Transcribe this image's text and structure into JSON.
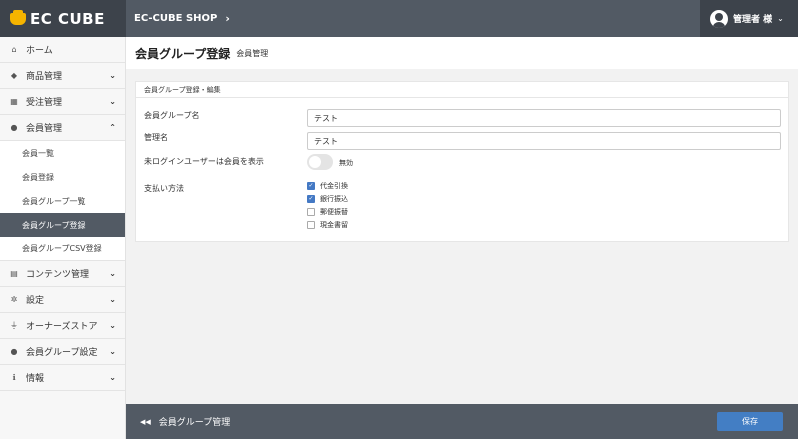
{
  "header": {
    "logo_text": "EC CUBE",
    "shop_name": "EC-CUBE SHOP",
    "shop_chevron": "›",
    "user_name": "管理者 様",
    "user_chevron": "⌄"
  },
  "sidebar": {
    "items": [
      {
        "label": "ホーム",
        "icon": "home-icon",
        "glyph": "⌂"
      },
      {
        "label": "商品管理",
        "icon": "cube-icon",
        "glyph": "◆",
        "arrow": "⌄"
      },
      {
        "label": "受注管理",
        "icon": "cart-icon",
        "glyph": "▦",
        "arrow": "⌄"
      },
      {
        "label": "会員管理",
        "icon": "users-icon",
        "glyph": "●",
        "arrow": "⌃"
      },
      {
        "label": "コンテンツ管理",
        "icon": "file-icon",
        "glyph": "▤",
        "arrow": "⌄"
      },
      {
        "label": "設定",
        "icon": "gear-icon",
        "glyph": "✲",
        "arrow": "⌄"
      },
      {
        "label": "オーナーズストア",
        "icon": "plug-icon",
        "glyph": "⏚",
        "arrow": "⌄"
      },
      {
        "label": "会員グループ設定",
        "icon": "users-icon",
        "glyph": "●",
        "arrow": "⌄"
      },
      {
        "label": "情報",
        "icon": "info-icon",
        "glyph": "ℹ",
        "arrow": "⌄"
      }
    ],
    "sub_items": [
      {
        "label": "会員一覧"
      },
      {
        "label": "会員登録"
      },
      {
        "label": "会員グループ一覧"
      },
      {
        "label": "会員グループ登録"
      },
      {
        "label": "会員グループCSV登録"
      }
    ]
  },
  "page": {
    "title": "会員グループ登録",
    "subtitle": "会員管理"
  },
  "card": {
    "title": "会員グループ登録・編集",
    "group_name_label": "会員グループ名",
    "group_name_value": "テスト",
    "admin_name_label": "管理名",
    "admin_name_value": "テスト",
    "non_login_label": "未ログインユーザーは会員を表示",
    "toggle_label": "無効",
    "payment_label": "支払い方法",
    "payments": [
      {
        "label": "代金引換",
        "checked": true,
        "mark": "✓"
      },
      {
        "label": "銀行振込",
        "checked": true,
        "mark": "✓"
      },
      {
        "label": "郵便振替",
        "checked": false,
        "mark": ""
      },
      {
        "label": "現金書留",
        "checked": false,
        "mark": ""
      }
    ]
  },
  "footer": {
    "back_icon": "◀◀",
    "back_label": "会員グループ管理",
    "save_label": "保存"
  },
  "colors": {
    "header": "#525a64",
    "header_dark": "#3d434b",
    "accent": "#437ec4",
    "logo": "#f5b400"
  }
}
